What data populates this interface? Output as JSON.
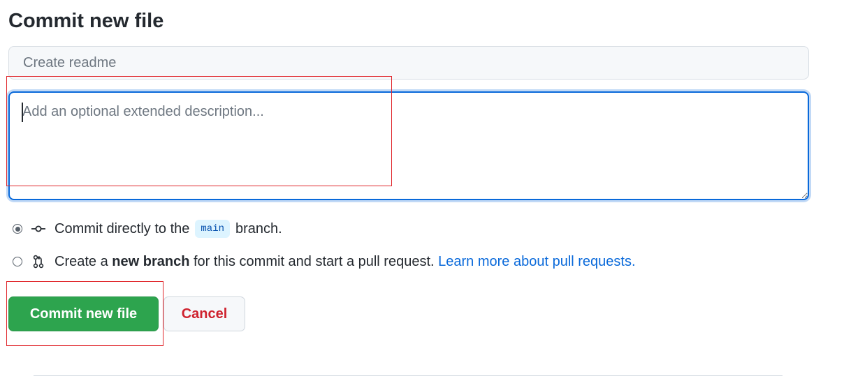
{
  "form": {
    "title": "Commit new file",
    "summary_placeholder": "Create readme",
    "description_placeholder": "Add an optional extended description..."
  },
  "options": {
    "direct": {
      "selected": true,
      "text_before": "Commit directly to the",
      "branch": "main",
      "text_after": "branch."
    },
    "new_branch": {
      "selected": false,
      "text_before": "Create a",
      "bold": "new branch",
      "text_after": "for this commit and start a pull request.",
      "link": "Learn more about pull requests."
    }
  },
  "buttons": {
    "commit_label": "Commit new file",
    "cancel_label": "Cancel"
  },
  "icons": {
    "commit": "git-commit-icon",
    "pull_request": "git-pull-request-icon"
  },
  "colors": {
    "primary_green": "#2da44e",
    "cancel_red": "#cf222e",
    "link_blue": "#0969da",
    "focus_blue": "#0969da",
    "annotation_red": "#e0262b"
  }
}
